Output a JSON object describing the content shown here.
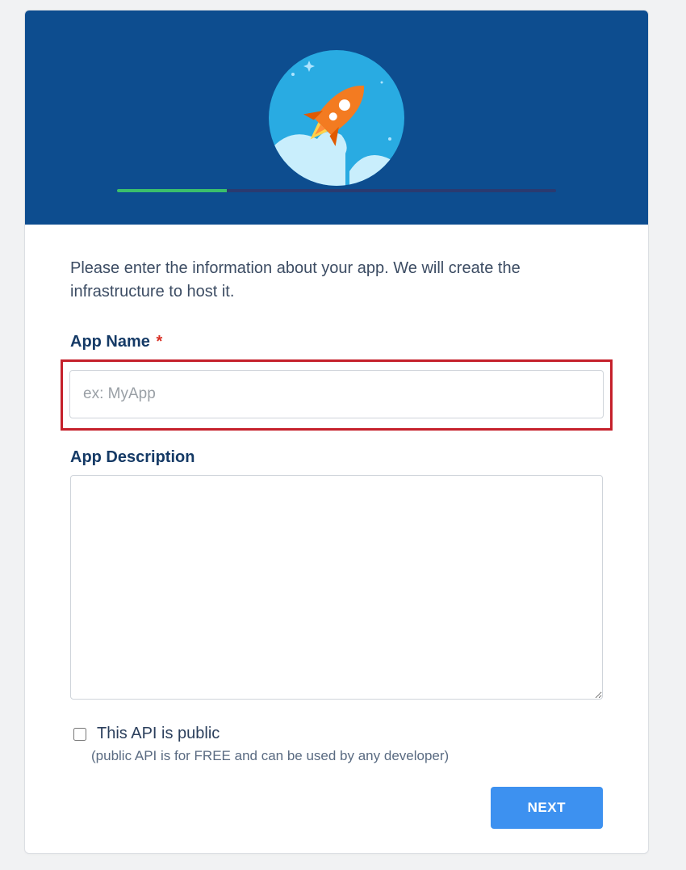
{
  "progress": {
    "percent": 25
  },
  "intro": "Please enter the information about your app. We will create the infrastructure to host it.",
  "fields": {
    "appName": {
      "label": "App Name",
      "required_marker": "*",
      "placeholder": "ex: MyApp",
      "value": ""
    },
    "appDescription": {
      "label": "App Description",
      "value": ""
    }
  },
  "public_api": {
    "checked": false,
    "label": "This API is public",
    "note": "(public API is for FREE and can be used by any developer)"
  },
  "actions": {
    "next_label": "NEXT"
  },
  "colors": {
    "hero_bg": "#0d4d8f",
    "progress_bg": "#2a3a70",
    "progress_fill": "#3bbf6b",
    "accent_button": "#3d91f0",
    "highlight_border": "#c5202b"
  }
}
